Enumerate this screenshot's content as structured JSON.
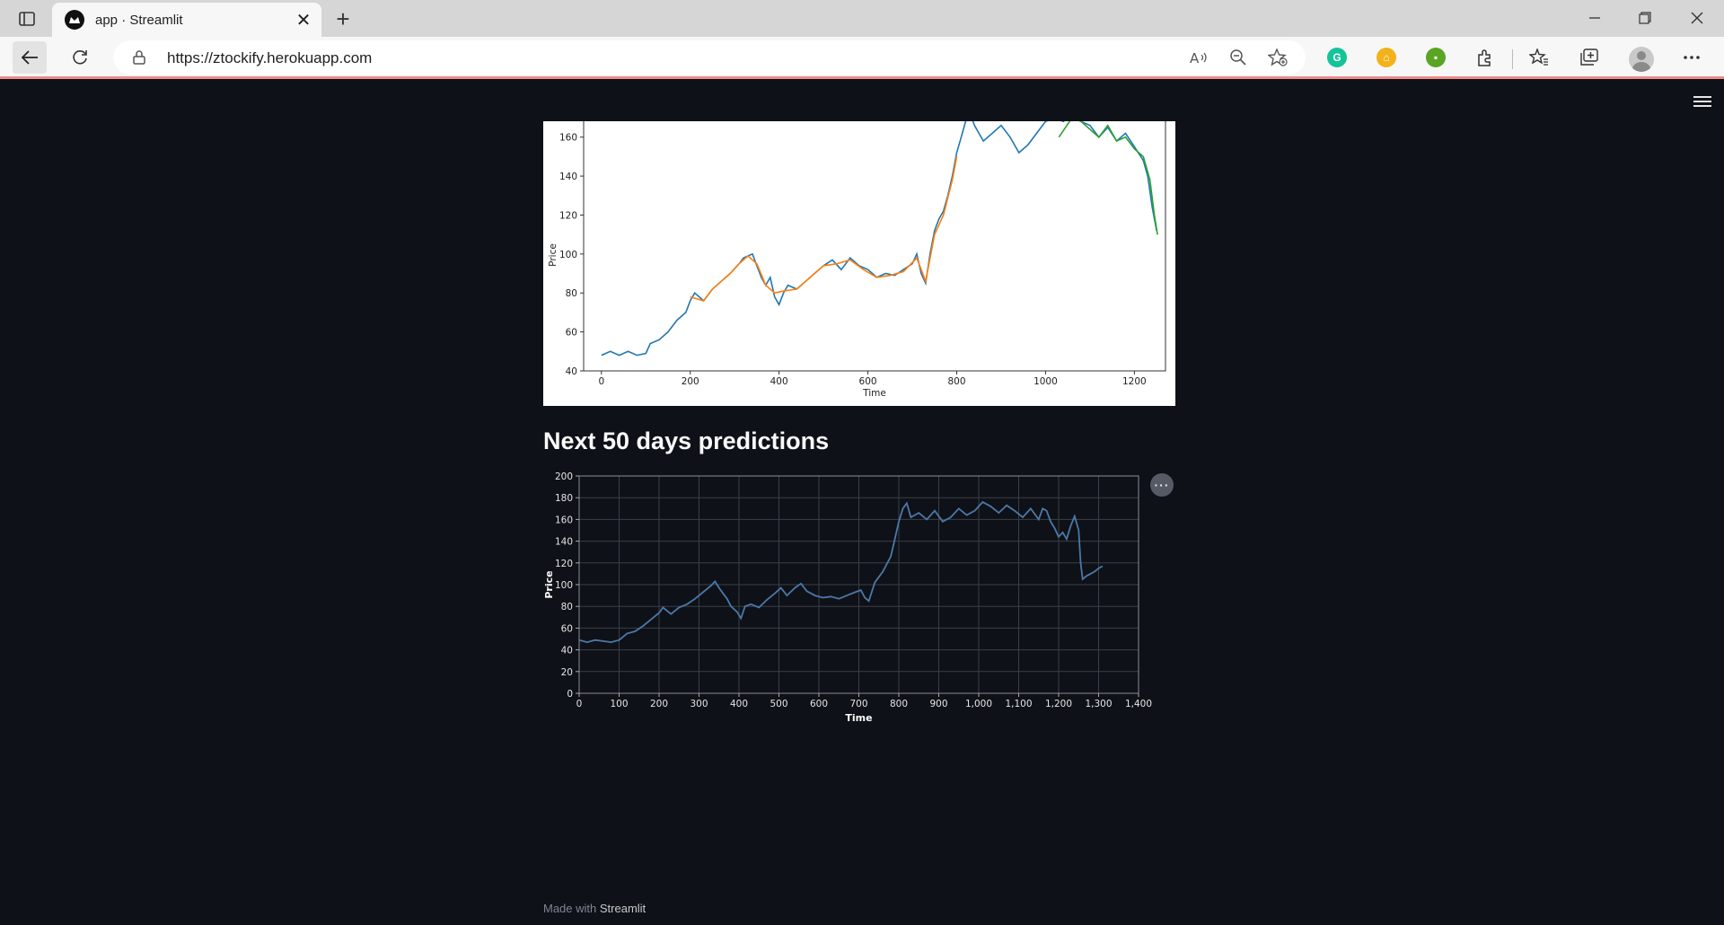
{
  "browser": {
    "tab_title": "app · Streamlit",
    "url": "https://ztockify.herokuapp.com",
    "ext_grammarly": "G",
    "ext_home": "⌂",
    "ext_green": "▪"
  },
  "app": {
    "heading": "Next 50 days predictions",
    "footer_prefix": "Made with",
    "footer_link": "Streamlit",
    "chart_menu": "···"
  },
  "colors": {
    "background": "#0e1117",
    "series_train": "#1f77b4",
    "series_test": "#ff7f0e",
    "series_predict": "#2ca02c",
    "vega_line": "#4c78a8"
  },
  "chart_data": [
    {
      "type": "line",
      "title": "",
      "xlabel": "Time",
      "ylabel": "Price",
      "xlim": [
        -40,
        1270
      ],
      "ylim": [
        40,
        170
      ],
      "xticks": [
        0,
        200,
        400,
        600,
        800,
        1000,
        1200
      ],
      "yticks": [
        40,
        60,
        80,
        100,
        120,
        140,
        160
      ],
      "series": [
        {
          "points": [
            [
              0,
              48
            ],
            [
              20,
              50
            ],
            [
              40,
              48
            ],
            [
              60,
              50
            ],
            [
              80,
              48
            ],
            [
              100,
              49
            ],
            [
              110,
              54
            ],
            [
              130,
              56
            ],
            [
              150,
              60
            ],
            [
              170,
              66
            ],
            [
              190,
              70
            ],
            [
              200,
              76
            ],
            [
              210,
              80
            ],
            [
              230,
              76
            ],
            [
              250,
              82
            ],
            [
              270,
              86
            ],
            [
              290,
              90
            ],
            [
              310,
              95
            ],
            [
              320,
              98
            ],
            [
              340,
              100
            ],
            [
              350,
              94
            ],
            [
              360,
              88
            ],
            [
              370,
              84
            ],
            [
              380,
              88
            ],
            [
              390,
              78
            ],
            [
              400,
              74
            ],
            [
              410,
              80
            ],
            [
              420,
              84
            ],
            [
              440,
              82
            ],
            [
              460,
              86
            ],
            [
              480,
              90
            ],
            [
              500,
              94
            ],
            [
              520,
              97
            ],
            [
              540,
              92
            ],
            [
              560,
              98
            ],
            [
              580,
              94
            ],
            [
              600,
              92
            ],
            [
              620,
              88
            ],
            [
              640,
              90
            ],
            [
              660,
              89
            ],
            [
              680,
              92
            ],
            [
              700,
              95
            ],
            [
              710,
              100
            ],
            [
              720,
              90
            ],
            [
              730,
              85
            ],
            [
              740,
              100
            ],
            [
              750,
              112
            ],
            [
              760,
              118
            ],
            [
              770,
              122
            ],
            [
              780,
              130
            ],
            [
              790,
              140
            ],
            [
              800,
              152
            ],
            [
              810,
              160
            ],
            [
              820,
              168
            ],
            [
              830,
              172
            ],
            [
              840,
              166
            ],
            [
              850,
              162
            ],
            [
              860,
              158
            ],
            [
              880,
              162
            ],
            [
              900,
              166
            ],
            [
              920,
              160
            ],
            [
              940,
              152
            ],
            [
              960,
              156
            ],
            [
              980,
              162
            ],
            [
              1000,
              168
            ],
            [
              1020,
              170
            ],
            [
              1040,
              168
            ],
            [
              1060,
              172
            ],
            [
              1080,
              168
            ],
            [
              1100,
              166
            ],
            [
              1120,
              160
            ],
            [
              1140,
              165
            ],
            [
              1160,
              158
            ],
            [
              1180,
              162
            ],
            [
              1200,
              155
            ],
            [
              1220,
              148
            ],
            [
              1230,
              140
            ],
            [
              1240,
              124
            ],
            [
              1250,
              112
            ]
          ]
        },
        {
          "points": [
            [
              200,
              78
            ],
            [
              230,
              76
            ],
            [
              250,
              82
            ],
            [
              270,
              86
            ],
            [
              290,
              90
            ],
            [
              310,
              95
            ],
            [
              330,
              99
            ],
            [
              350,
              95
            ],
            [
              370,
              84
            ],
            [
              390,
              80
            ],
            [
              410,
              81
            ],
            [
              440,
              82
            ],
            [
              470,
              88
            ],
            [
              500,
              94
            ],
            [
              530,
              95
            ],
            [
              560,
              97
            ],
            [
              590,
              92
            ],
            [
              620,
              88
            ],
            [
              650,
              89
            ],
            [
              680,
              91
            ],
            [
              710,
              98
            ],
            [
              730,
              86
            ],
            [
              750,
              110
            ],
            [
              770,
              120
            ],
            [
              790,
              138
            ],
            [
              800,
              150
            ]
          ]
        },
        {
          "points": [
            [
              1030,
              160
            ],
            [
              1060,
              170
            ],
            [
              1080,
              168
            ],
            [
              1100,
              164
            ],
            [
              1120,
              160
            ],
            [
              1140,
              166
            ],
            [
              1160,
              158
            ],
            [
              1180,
              160
            ],
            [
              1200,
              154
            ],
            [
              1220,
              150
            ],
            [
              1235,
              138
            ],
            [
              1245,
              120
            ],
            [
              1252,
              110
            ]
          ]
        }
      ]
    },
    {
      "type": "line",
      "title": "",
      "xlabel": "Time",
      "ylabel": "Price",
      "xlim": [
        0,
        1400
      ],
      "ylim": [
        0,
        200
      ],
      "xticks": [
        0,
        100,
        200,
        300,
        400,
        500,
        600,
        700,
        800,
        900,
        1000,
        1100,
        1200,
        1300,
        1400
      ],
      "xtick_labels": [
        "0",
        "100",
        "200",
        "300",
        "400",
        "500",
        "600",
        "700",
        "800",
        "900",
        "1,000",
        "1,100",
        "1,200",
        "1,300",
        "1,400"
      ],
      "yticks": [
        0,
        20,
        40,
        60,
        80,
        100,
        120,
        140,
        160,
        180,
        200
      ],
      "series": [
        {
          "points": [
            [
              0,
              49
            ],
            [
              20,
              47
            ],
            [
              40,
              49
            ],
            [
              60,
              48
            ],
            [
              80,
              47
            ],
            [
              100,
              49
            ],
            [
              120,
              55
            ],
            [
              140,
              57
            ],
            [
              160,
              62
            ],
            [
              180,
              68
            ],
            [
              200,
              74
            ],
            [
              210,
              79
            ],
            [
              230,
              73
            ],
            [
              250,
              79
            ],
            [
              270,
              82
            ],
            [
              290,
              87
            ],
            [
              310,
              93
            ],
            [
              330,
              99
            ],
            [
              340,
              103
            ],
            [
              350,
              97
            ],
            [
              360,
              92
            ],
            [
              370,
              87
            ],
            [
              380,
              80
            ],
            [
              395,
              75
            ],
            [
              405,
              69
            ],
            [
              415,
              80
            ],
            [
              430,
              82
            ],
            [
              450,
              79
            ],
            [
              470,
              86
            ],
            [
              490,
              92
            ],
            [
              505,
              97
            ],
            [
              520,
              90
            ],
            [
              540,
              97
            ],
            [
              555,
              101
            ],
            [
              570,
              94
            ],
            [
              590,
              90
            ],
            [
              610,
              88
            ],
            [
              630,
              89
            ],
            [
              650,
              87
            ],
            [
              670,
              90
            ],
            [
              690,
              93
            ],
            [
              705,
              95
            ],
            [
              715,
              88
            ],
            [
              725,
              85
            ],
            [
              740,
              102
            ],
            [
              760,
              112
            ],
            [
              780,
              126
            ],
            [
              790,
              142
            ],
            [
              800,
              158
            ],
            [
              810,
              170
            ],
            [
              820,
              175
            ],
            [
              830,
              162
            ],
            [
              850,
              166
            ],
            [
              870,
              160
            ],
            [
              890,
              168
            ],
            [
              910,
              158
            ],
            [
              930,
              162
            ],
            [
              950,
              170
            ],
            [
              970,
              164
            ],
            [
              990,
              168
            ],
            [
              1010,
              176
            ],
            [
              1030,
              172
            ],
            [
              1050,
              166
            ],
            [
              1070,
              173
            ],
            [
              1090,
              168
            ],
            [
              1110,
              162
            ],
            [
              1130,
              170
            ],
            [
              1150,
              160
            ],
            [
              1160,
              170
            ],
            [
              1170,
              168
            ],
            [
              1180,
              158
            ],
            [
              1190,
              152
            ],
            [
              1200,
              144
            ],
            [
              1210,
              148
            ],
            [
              1220,
              142
            ],
            [
              1230,
              154
            ],
            [
              1240,
              163
            ],
            [
              1250,
              150
            ],
            [
              1255,
              120
            ],
            [
              1260,
              105
            ],
            [
              1270,
              108
            ],
            [
              1280,
              110
            ],
            [
              1290,
              112
            ],
            [
              1300,
              115
            ],
            [
              1310,
              117
            ]
          ]
        }
      ]
    }
  ]
}
